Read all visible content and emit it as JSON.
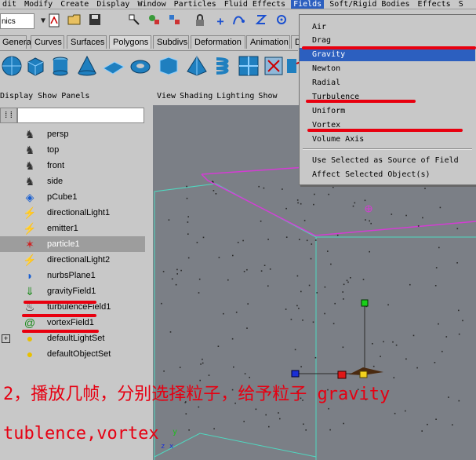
{
  "menubar": {
    "items": [
      "dit",
      "Modify",
      "Create",
      "Display",
      "Window",
      "Particles",
      "Fluid Effects",
      "Fields",
      "Soft/Rigid Bodies",
      "Effects",
      "S"
    ],
    "active_index": 7
  },
  "toolbar": {
    "mode_select": "nics"
  },
  "shelf_tabs": [
    "General",
    "Curves",
    "Surfaces",
    "Polygons",
    "Subdivs",
    "Deformation",
    "Animation",
    "D"
  ],
  "shelf_tabs_selected_index": 3,
  "outliner": {
    "menu": [
      "Display",
      "Show",
      "Panels"
    ],
    "items": [
      {
        "label": "persp",
        "icon": "camera-icon"
      },
      {
        "label": "top",
        "icon": "camera-icon"
      },
      {
        "label": "front",
        "icon": "camera-icon"
      },
      {
        "label": "side",
        "icon": "camera-icon"
      },
      {
        "label": "pCube1",
        "icon": "mesh-icon"
      },
      {
        "label": "directionalLight1",
        "icon": "light-icon"
      },
      {
        "label": "emitter1",
        "icon": "emitter-icon"
      },
      {
        "label": "particle1",
        "icon": "particle-icon",
        "selected": true
      },
      {
        "label": "directionalLight2",
        "icon": "light-icon"
      },
      {
        "label": "nurbsPlane1",
        "icon": "nurbs-icon"
      },
      {
        "label": "gravityField1",
        "icon": "gravity-icon"
      },
      {
        "label": "turbulenceField1",
        "icon": "turbulence-icon"
      },
      {
        "label": "vortexField1",
        "icon": "vortex-icon"
      },
      {
        "label": "defaultLightSet",
        "icon": "set-icon",
        "expandable": true
      },
      {
        "label": "defaultObjectSet",
        "icon": "set-icon"
      }
    ]
  },
  "viewport": {
    "menu": [
      "View",
      "Shading",
      "Lighting",
      "Show"
    ]
  },
  "fields_menu": {
    "items": [
      "Air",
      "Drag",
      "Gravity",
      "Newton",
      "Radial",
      "Turbulence",
      "Uniform",
      "Vortex",
      "Volume Axis"
    ],
    "highlighted_index": 2,
    "extra_items": [
      "Use Selected as Source of Field",
      "Affect Selected Object(s)"
    ]
  },
  "annotation": {
    "line1": "2，播放几帧，分别选择粒子，给予粒子 gravity",
    "line2": "tublence,vortex"
  },
  "colors": {
    "menu_highlight": "#2c5fbf",
    "annotation_red": "#e60012",
    "ui_gray": "#c8c8c8",
    "viewport_bg": "#7b7f86"
  }
}
